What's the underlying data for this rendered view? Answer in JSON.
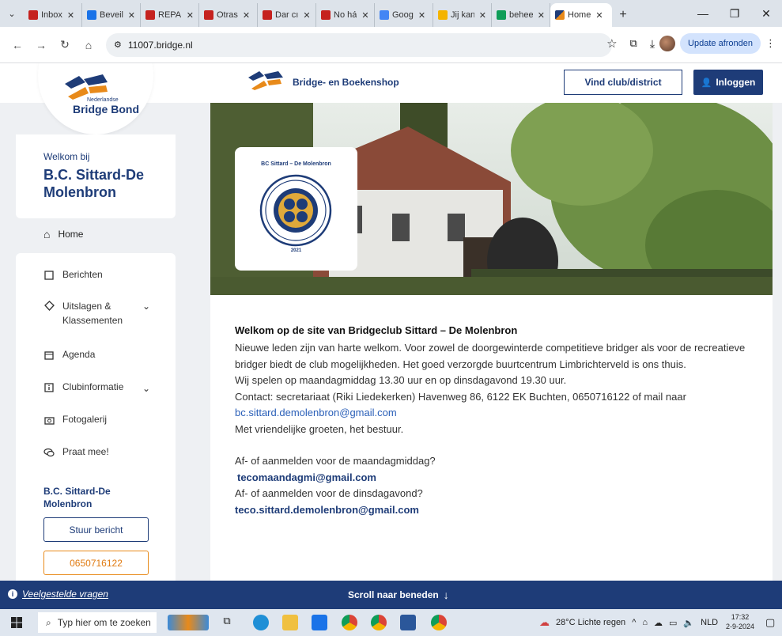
{
  "browser": {
    "tabs": [
      {
        "label": "Inbox",
        "color": "#c5221f"
      },
      {
        "label": "Beveili",
        "color": "#1a73e8"
      },
      {
        "label": "REPAI",
        "color": "#c5221f"
      },
      {
        "label": "Otras",
        "color": "#c5221f"
      },
      {
        "label": "Dar cı",
        "color": "#c5221f"
      },
      {
        "label": "No há",
        "color": "#c5221f"
      },
      {
        "label": "Goog",
        "color": "#4285f4"
      },
      {
        "label": "Jij kan",
        "color": "#f4b400"
      },
      {
        "label": "behee",
        "color": "#0f9d58"
      }
    ],
    "active_tab": "Home",
    "address": "11007.bridge.nl",
    "update_button": "Update afronden"
  },
  "header": {
    "logo_small": "Nederlandse",
    "logo_text": "Bridge Bond",
    "shop_link": "Bridge- en Boekenshop",
    "find_club": "Vind club/district",
    "login": "Inloggen"
  },
  "sidebar": {
    "welcome_label": "Welkom bij",
    "club_name": "B.C. Sittard-De Molenbron",
    "home": "Home",
    "items": [
      {
        "label": "Berichten",
        "icon": "message-icon"
      },
      {
        "label": "Uitslagen & Klassementen",
        "icon": "trophy-icon"
      },
      {
        "label": "Agenda",
        "icon": "calendar-icon"
      },
      {
        "label": "Clubinformatie",
        "icon": "info-icon"
      },
      {
        "label": "Fotogalerij",
        "icon": "camera-icon"
      },
      {
        "label": "Praat mee!",
        "icon": "chat-icon"
      }
    ],
    "club_block": "B.C. Sittard-De Molenbron",
    "send_message": "Stuur bericht",
    "phone": "0650716122"
  },
  "hero": {
    "badge_title": "BC Sittard – De Molenbron",
    "badge_year": "2021"
  },
  "content": {
    "title": "Welkom op de site van Bridgeclub Sittard – De Molenbron",
    "para1": "Nieuwe leden zijn van harte welkom. Voor zowel de doorgewinterde competitieve bridger als voor de recreatieve bridger biedt de club mogelijkheden. Het goed verzorgde buurtcentrum Limbrichterveld is ons thuis.",
    "play_times": "Wij spelen op maandagmiddag 13.30 uur en op dinsdagavond 19.30 uur.",
    "contact": "Contact: secretariaat (Riki Liedekerken)  Havenweg 86, 6122 EK Buchten,  0650716122 of mail naar",
    "contact_email": "bc.sittard.demolenbron@gmail.com",
    "greeting": "Met vriendelijke groeten,  het bestuur.",
    "monday_q": "Af- of aanmelden voor de maandagmiddag?",
    "monday_email": "tecomaandagmi@gmail.com",
    "tuesday_q": "Af- of aanmelden voor de dinsdagavond?",
    "tuesday_email": "teco.sittard.demolenbron@gmail.com"
  },
  "bottom_bar": {
    "faq": "Veelgestelde vragen",
    "scroll": "Scroll naar beneden"
  },
  "taskbar": {
    "search_placeholder": "Typ hier om te zoeken",
    "weather": "28°C  Lichte regen",
    "language": "NLD",
    "time": "17:32",
    "date": "2-9-2024"
  },
  "colors": {
    "brand_blue": "#1e3c78",
    "brand_orange": "#e88a1a"
  }
}
